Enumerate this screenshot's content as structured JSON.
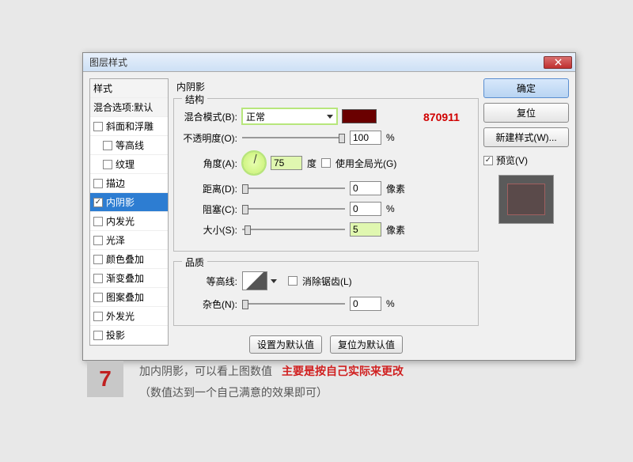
{
  "dialog": {
    "title": "图层样式",
    "styles_header": "样式",
    "blend_default": "混合选项:默认",
    "items": [
      {
        "label": "斜面和浮雕",
        "checked": false,
        "indent": false
      },
      {
        "label": "等高线",
        "checked": false,
        "indent": true
      },
      {
        "label": "纹理",
        "checked": false,
        "indent": true
      },
      {
        "label": "描边",
        "checked": false,
        "indent": false
      },
      {
        "label": "内阴影",
        "checked": true,
        "indent": false,
        "selected": true
      },
      {
        "label": "内发光",
        "checked": false,
        "indent": false
      },
      {
        "label": "光泽",
        "checked": false,
        "indent": false
      },
      {
        "label": "颜色叠加",
        "checked": false,
        "indent": false
      },
      {
        "label": "渐变叠加",
        "checked": false,
        "indent": false
      },
      {
        "label": "图案叠加",
        "checked": false,
        "indent": false
      },
      {
        "label": "外发光",
        "checked": false,
        "indent": false
      },
      {
        "label": "投影",
        "checked": false,
        "indent": false
      }
    ]
  },
  "center": {
    "title": "内阴影",
    "struct_legend": "结构",
    "blend_mode_label": "混合模式(B):",
    "blend_mode_value": "正常",
    "opacity_label": "不透明度(O):",
    "opacity_value": "100",
    "opacity_unit": "%",
    "angle_label": "角度(A):",
    "angle_value": "75",
    "angle_unit": "度",
    "global_light": "使用全局光(G)",
    "distance_label": "距离(D):",
    "distance_value": "0",
    "distance_unit": "像素",
    "choke_label": "阻塞(C):",
    "choke_value": "0",
    "choke_unit": "%",
    "size_label": "大小(S):",
    "size_value": "5",
    "size_unit": "像素",
    "quality_legend": "品质",
    "contour_label": "等高线:",
    "antialias": "消除锯齿(L)",
    "noise_label": "杂色(N):",
    "noise_value": "0",
    "noise_unit": "%",
    "make_default": "设置为默认值",
    "reset_default": "复位为默认值"
  },
  "right": {
    "ok": "确定",
    "reset": "复位",
    "new_style": "新建样式(W)...",
    "preview": "预览(V)"
  },
  "overlay_number": "870911",
  "footer": {
    "step": "7",
    "line1a": "加内阴影，可以看上图数值",
    "line1b": "主要是按自己实际来更改",
    "line2": "（数值达到一个自己满意的效果即可）"
  }
}
